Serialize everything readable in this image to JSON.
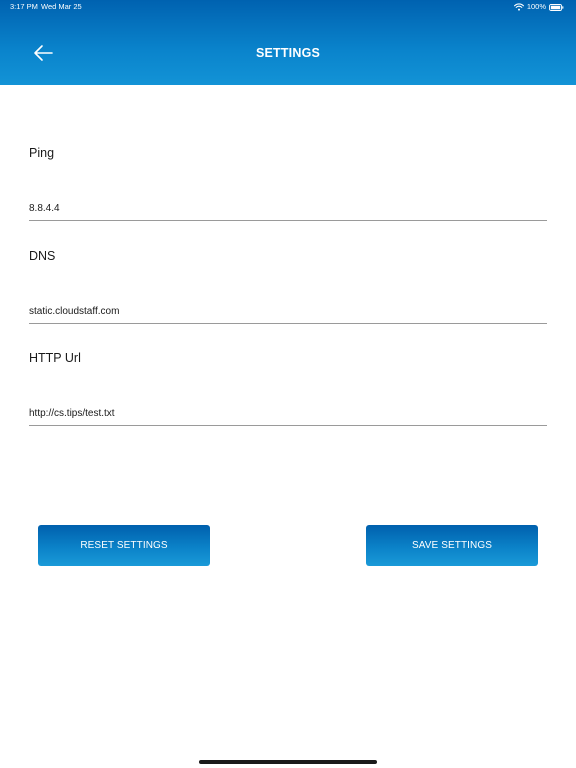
{
  "status_bar": {
    "time": "3:17 PM",
    "date": "Wed Mar 25",
    "battery": "100%",
    "icons": [
      "wifi-icon",
      "battery-icon"
    ]
  },
  "header": {
    "title": "SETTINGS",
    "back_icon": "arrow-left-icon"
  },
  "fields": {
    "ping": {
      "label": "Ping",
      "value": "8.8.4.4"
    },
    "dns": {
      "label": "DNS",
      "value": "static.cloudstaff.com"
    },
    "http_url": {
      "label": "HTTP Url",
      "value": "http://cs.tips/test.txt"
    }
  },
  "buttons": {
    "reset_label": "RESET SETTINGS",
    "save_label": "SAVE SETTINGS"
  },
  "colors": {
    "header_top": "#0062b0",
    "header_bottom": "#1393d6",
    "button_gradient_top": "#0060ad",
    "button_gradient_bottom": "#1a9ad8",
    "underline": "#9a9a9a"
  }
}
